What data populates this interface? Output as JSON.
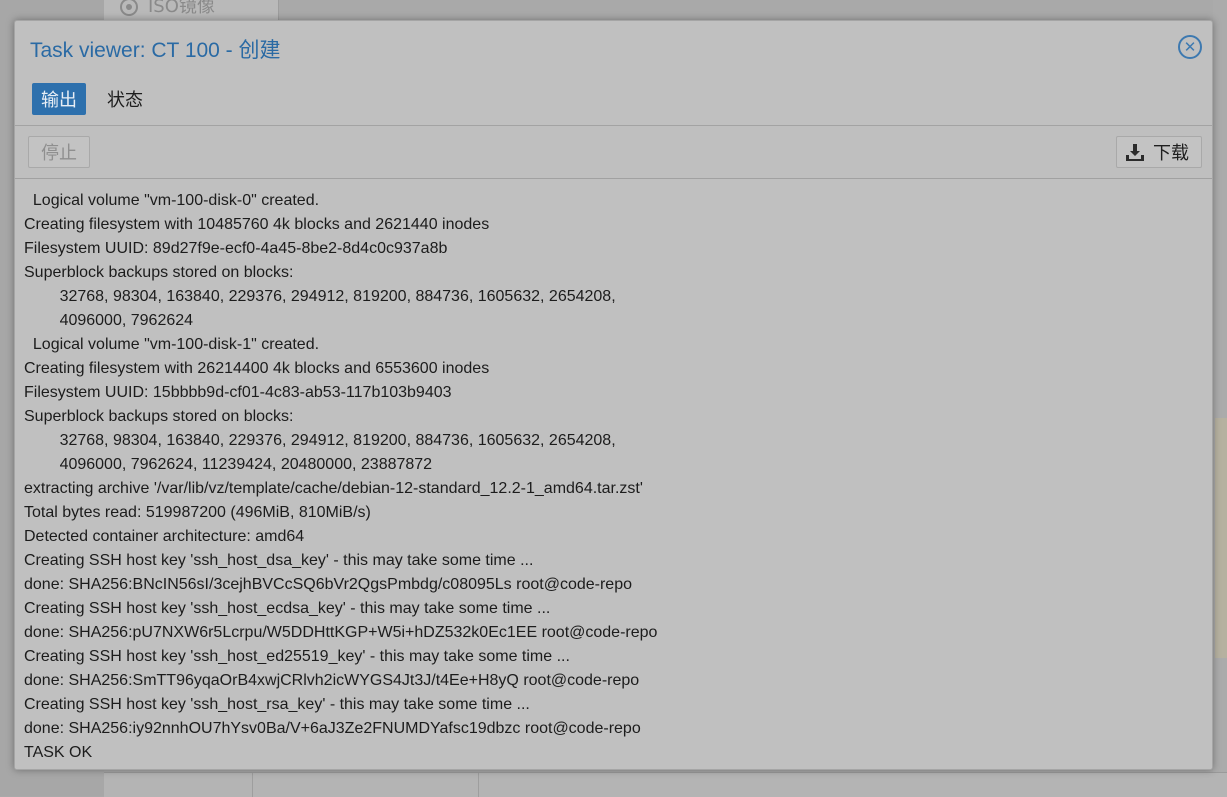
{
  "background": {
    "iso_tab_label": "ISO镜像"
  },
  "dialog": {
    "title": "Task viewer: CT 100 - 创建",
    "close_icon": "close-circle-icon",
    "tabs": [
      {
        "label": "输出",
        "active": true
      },
      {
        "label": "状态",
        "active": false
      }
    ],
    "toolbar": {
      "stop_label": "停止",
      "stop_enabled": false,
      "download_label": "下载",
      "download_icon": "download-icon"
    },
    "log_lines": [
      "  Logical volume \"vm-100-disk-0\" created.",
      "Creating filesystem with 10485760 4k blocks and 2621440 inodes",
      "Filesystem UUID: 89d27f9e-ecf0-4a45-8be2-8d4c0c937a8b",
      "Superblock backups stored on blocks:",
      "        32768, 98304, 163840, 229376, 294912, 819200, 884736, 1605632, 2654208,",
      "        4096000, 7962624",
      "  Logical volume \"vm-100-disk-1\" created.",
      "Creating filesystem with 26214400 4k blocks and 6553600 inodes",
      "Filesystem UUID: 15bbbb9d-cf01-4c83-ab53-117b103b9403",
      "Superblock backups stored on blocks:",
      "        32768, 98304, 163840, 229376, 294912, 819200, 884736, 1605632, 2654208,",
      "        4096000, 7962624, 11239424, 20480000, 23887872",
      "extracting archive '/var/lib/vz/template/cache/debian-12-standard_12.2-1_amd64.tar.zst'",
      "Total bytes read: 519987200 (496MiB, 810MiB/s)",
      "Detected container architecture: amd64",
      "Creating SSH host key 'ssh_host_dsa_key' - this may take some time ...",
      "done: SHA256:BNcIN56sI/3cejhBVCcSQ6bVr2QgsPmbdg/c08095Ls root@code-repo",
      "Creating SSH host key 'ssh_host_ecdsa_key' - this may take some time ...",
      "done: SHA256:pU7NXW6r5Lcrpu/W5DDHttKGP+W5i+hDZ532k0Ec1EE root@code-repo",
      "Creating SSH host key 'ssh_host_ed25519_key' - this may take some time ...",
      "done: SHA256:SmTT96yqaOrB4xwjCRlvh2icWYGS4Jt3J/t4Ee+H8yQ root@code-repo",
      "Creating SSH host key 'ssh_host_rsa_key' - this may take some time ...",
      "done: SHA256:iy92nnhOU7hYsv0Ba/V+6aJ3Ze2FNUMDYafsc19dbzc root@code-repo",
      "TASK OK"
    ]
  },
  "colors": {
    "title_blue": "#2a6aa4",
    "tab_active_bg": "#2d70ad",
    "mask_gray": "#c0c0c0"
  }
}
